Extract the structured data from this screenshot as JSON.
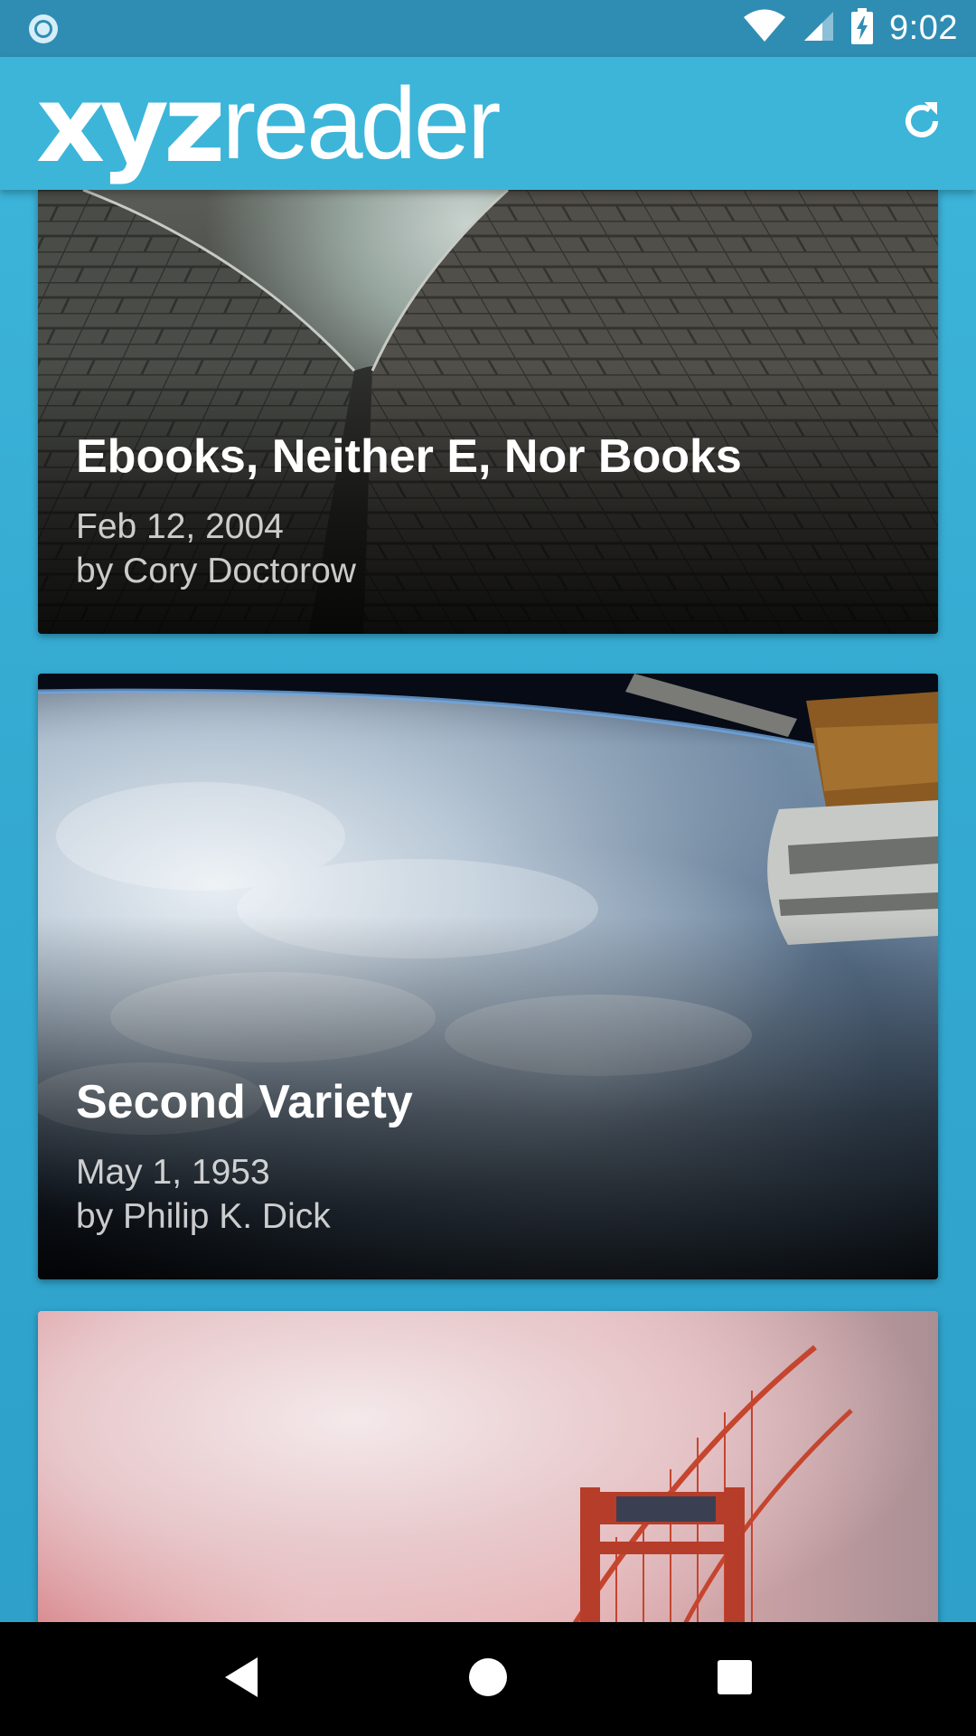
{
  "status_bar": {
    "time": "9:02",
    "icons": [
      "notification-dot-icon",
      "wifi-icon",
      "cell-signal-icon",
      "battery-charging-icon"
    ]
  },
  "app_bar": {
    "logo_bold": "xyz",
    "logo_thin": "reader",
    "action_icon": "refresh-icon"
  },
  "articles": [
    {
      "title": "Ebooks, Neither E, Nor Books",
      "date": "Feb 12, 2004",
      "author": "by Cory Doctorow",
      "image": "opera-house-roof-photo"
    },
    {
      "title": "Second Variety",
      "date": "May 1, 1953",
      "author": "by Philip K. Dick",
      "image": "earth-from-space-station-photo"
    },
    {
      "title": "",
      "date": "",
      "author": "",
      "image": "golden-gate-bridge-fog-photo"
    }
  ],
  "nav_bar": {
    "icons": [
      "back-icon",
      "home-icon",
      "recents-icon"
    ]
  },
  "colors": {
    "primary": "#3cb5d9",
    "status_bar": "#2f8db4",
    "background": "#33a8d0",
    "nav_bar": "#000000"
  }
}
